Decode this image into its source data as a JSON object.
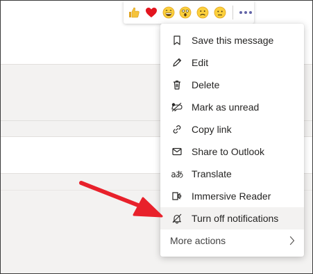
{
  "reactions": [
    {
      "name": "like",
      "glyph": "👍"
    },
    {
      "name": "heart",
      "glyph": "❤"
    },
    {
      "name": "laugh",
      "glyph": "😄"
    },
    {
      "name": "surprised",
      "glyph": "😮"
    },
    {
      "name": "sad",
      "glyph": "☹"
    },
    {
      "name": "angry",
      "glyph": "🙁"
    }
  ],
  "menu": {
    "items": [
      {
        "label": "Save this message",
        "icon": "bookmark-icon"
      },
      {
        "label": "Edit",
        "icon": "pencil-icon"
      },
      {
        "label": "Delete",
        "icon": "trash-icon"
      },
      {
        "label": "Mark as unread",
        "icon": "unread-icon"
      },
      {
        "label": "Copy link",
        "icon": "link-icon"
      },
      {
        "label": "Share to Outlook",
        "icon": "mail-icon"
      },
      {
        "label": "Translate",
        "icon": "translate-icon"
      },
      {
        "label": "Immersive Reader",
        "icon": "immersive-reader-icon"
      },
      {
        "label": "Turn off notifications",
        "icon": "bell-off-icon"
      }
    ],
    "more_actions": "More actions",
    "translate_glyph": "aあ"
  },
  "colors": {
    "accent": "#6264a7",
    "annotation": "#e8212b",
    "highlight": "#f3f2f1"
  }
}
